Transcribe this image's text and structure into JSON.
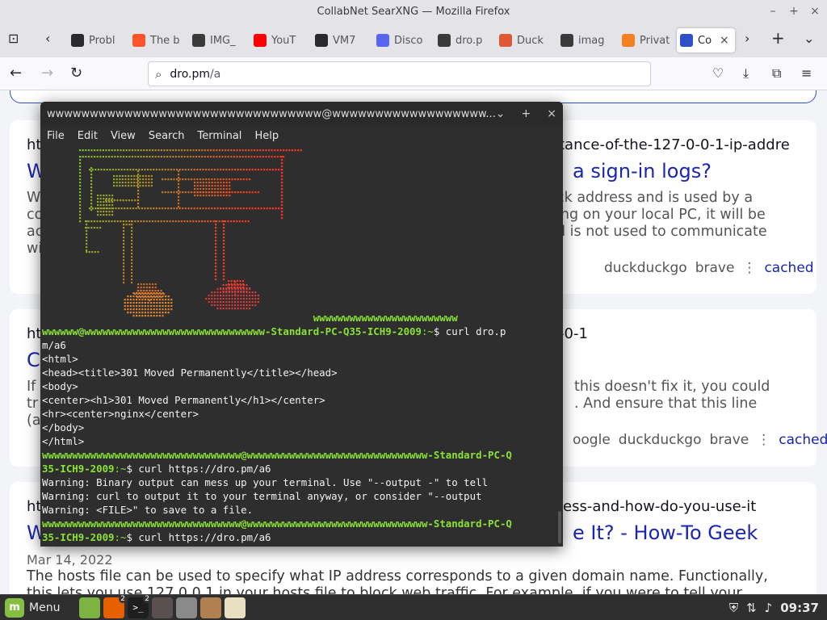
{
  "window": {
    "title": "CollabNet SearXNG — Mozilla Firefox"
  },
  "tabs": [
    {
      "label": "Probl",
      "icon": "info-icon",
      "favcolor": "#2a2a2e"
    },
    {
      "label": "The b",
      "icon": "brave-icon",
      "favcolor": "#fb542b"
    },
    {
      "label": "IMG_",
      "icon": "image-icon",
      "favcolor": "#3a3a3a"
    },
    {
      "label": "YouT",
      "icon": "youtube-icon",
      "favcolor": "#ff0000"
    },
    {
      "label": "VM7",
      "icon": "vm-icon",
      "favcolor": "#2a2a2e"
    },
    {
      "label": "Disco",
      "icon": "discord-icon",
      "favcolor": "#5865f2"
    },
    {
      "label": "dro.p",
      "icon": "image-icon",
      "favcolor": "#3a3a3a"
    },
    {
      "label": "Duck",
      "icon": "duckduckgo-icon",
      "favcolor": "#de5833"
    },
    {
      "label": "imag",
      "icon": "image-icon",
      "favcolor": "#3a3a3a"
    },
    {
      "label": "Privat",
      "icon": "privacy-icon",
      "favcolor": "#f48120"
    },
    {
      "label": "Co",
      "icon": "search-icon",
      "favcolor": "#3050c8",
      "active": true
    }
  ],
  "nav": {
    "url_host": "dro.pm",
    "url_path": "/a"
  },
  "results": [
    {
      "url": "htt",
      "url_tail": "tance-of-the-127-0-0-1-ip-addre",
      "title_head": "W",
      "title_tail": "a sign-in logs?",
      "snippet_left": [
        "W",
        "co",
        "ac",
        "wi"
      ],
      "snippet_right": [
        "ck address and is used by a",
        "ing on your local PC, it will be",
        "d is not used to communicate"
      ],
      "engines": [
        "duckduckgo",
        "brave"
      ],
      "cached": "cached"
    },
    {
      "url": "ht",
      "url_tail": "-0-1",
      "title_head": "C",
      "snippet_left": [
        "If",
        "tr",
        "(a"
      ],
      "snippet_right": [
        "this doesn't fix it, you could",
        ". And ensure that this line"
      ],
      "engines": [
        "oogle",
        "duckduckgo",
        "brave"
      ],
      "cached": "cached"
    },
    {
      "url": "ht",
      "url_tail": "ess-and-how-do-you-use-it",
      "title_head": "W",
      "title_tail": "e It? - How-To Geek",
      "date": "Mar 14, 2022",
      "body": [
        "The hosts file can be used to specify what IP address corresponds to a given domain name. Functionally,",
        "this lets you use 127.0.0.1 in your hosts file to block web traffic. For example, if you were to tell your"
      ]
    }
  ],
  "terminal": {
    "title": "wwwwwwwwwwwwwwwwwwwwwwwwwwwwwwww@wwwwwwwwwwwwwwwwww...",
    "menu": [
      "File",
      "Edit",
      "View",
      "Search",
      "Terminal",
      "Help"
    ],
    "lines": [
      {
        "segs": [
          {
            "t": "                                             wwwwwwwwwwwwwwwwwwwwwwww",
            "c": "g"
          }
        ]
      },
      {
        "segs": [
          {
            "t": "wwwwww@wwwwwwwwwwwwwwwwwwwwwwwwwwwwww-Standard-PC-Q35-ICH9-2009",
            "c": "g"
          },
          {
            "t": ":~",
            "c": "b"
          },
          {
            "t": "$ curl dro.p",
            "c": ""
          }
        ]
      },
      {
        "segs": [
          {
            "t": "m/a6",
            "c": ""
          }
        ]
      },
      {
        "segs": [
          {
            "t": "<html>",
            "c": ""
          }
        ]
      },
      {
        "segs": [
          {
            "t": "<head><title>301 Moved Permanently</title></head>",
            "c": ""
          }
        ]
      },
      {
        "segs": [
          {
            "t": "<body>",
            "c": ""
          }
        ]
      },
      {
        "segs": [
          {
            "t": "<center><h1>301 Moved Permanently</h1></center>",
            "c": ""
          }
        ]
      },
      {
        "segs": [
          {
            "t": "<hr><center>nginx</center>",
            "c": ""
          }
        ]
      },
      {
        "segs": [
          {
            "t": "</body>",
            "c": ""
          }
        ]
      },
      {
        "segs": [
          {
            "t": "</html>",
            "c": ""
          }
        ]
      },
      {
        "segs": [
          {
            "t": "wwwwwwwwwwwwwwwwwwwwwwwwwwwwwwwww@wwwwwwwwwwwwwwwwwwwwwwwwwwwwww-Standard-PC-Q",
            "c": "g"
          }
        ]
      },
      {
        "segs": [
          {
            "t": "35-ICH9-2009",
            "c": "g"
          },
          {
            "t": ":~",
            "c": "b"
          },
          {
            "t": "$ curl https://dro.pm/a6",
            "c": ""
          }
        ]
      },
      {
        "segs": [
          {
            "t": "Warning: Binary output can mess up your terminal. Use \"--output -\" to tell",
            "c": ""
          }
        ]
      },
      {
        "segs": [
          {
            "t": "Warning: curl to output it to your terminal anyway, or consider \"--output",
            "c": ""
          }
        ]
      },
      {
        "segs": [
          {
            "t": "Warning: <FILE>\" to save to a file.",
            "c": ""
          }
        ]
      },
      {
        "segs": [
          {
            "t": "wwwwwwwwwwwwwwwwwwwwwwwwwwwwwwwww@wwwwwwwwwwwwwwwwwwwwwwwwwwwwww-Standard-PC-Q",
            "c": "g"
          }
        ]
      },
      {
        "segs": [
          {
            "t": "35-ICH9-2009",
            "c": "g"
          },
          {
            "t": ":~",
            "c": "b"
          },
          {
            "t": "$ curl https://dro.pm/a6",
            "c": ""
          }
        ]
      }
    ]
  },
  "panel": {
    "menu_label": "Menu",
    "launchers": [
      {
        "name": "files-launcher",
        "bg": "#7cb342",
        "glyph": "",
        "badge": ""
      },
      {
        "name": "firefox-launcher",
        "bg": "#e66000",
        "glyph": "",
        "badge": "2"
      },
      {
        "name": "terminal-launcher",
        "bg": "#1e1e1e",
        "glyph": ">_",
        "badge": "2"
      },
      {
        "name": "app-launcher-1",
        "bg": "#5a5050",
        "glyph": "",
        "badge": ""
      },
      {
        "name": "app-launcher-2",
        "bg": "#8a8a8a",
        "glyph": "",
        "badge": ""
      },
      {
        "name": "app-launcher-3",
        "bg": "#b08050",
        "glyph": "",
        "badge": ""
      },
      {
        "name": "text-editor-launcher",
        "bg": "#e8e0c0",
        "glyph": "",
        "badge": ""
      }
    ],
    "clock": "09:37"
  }
}
